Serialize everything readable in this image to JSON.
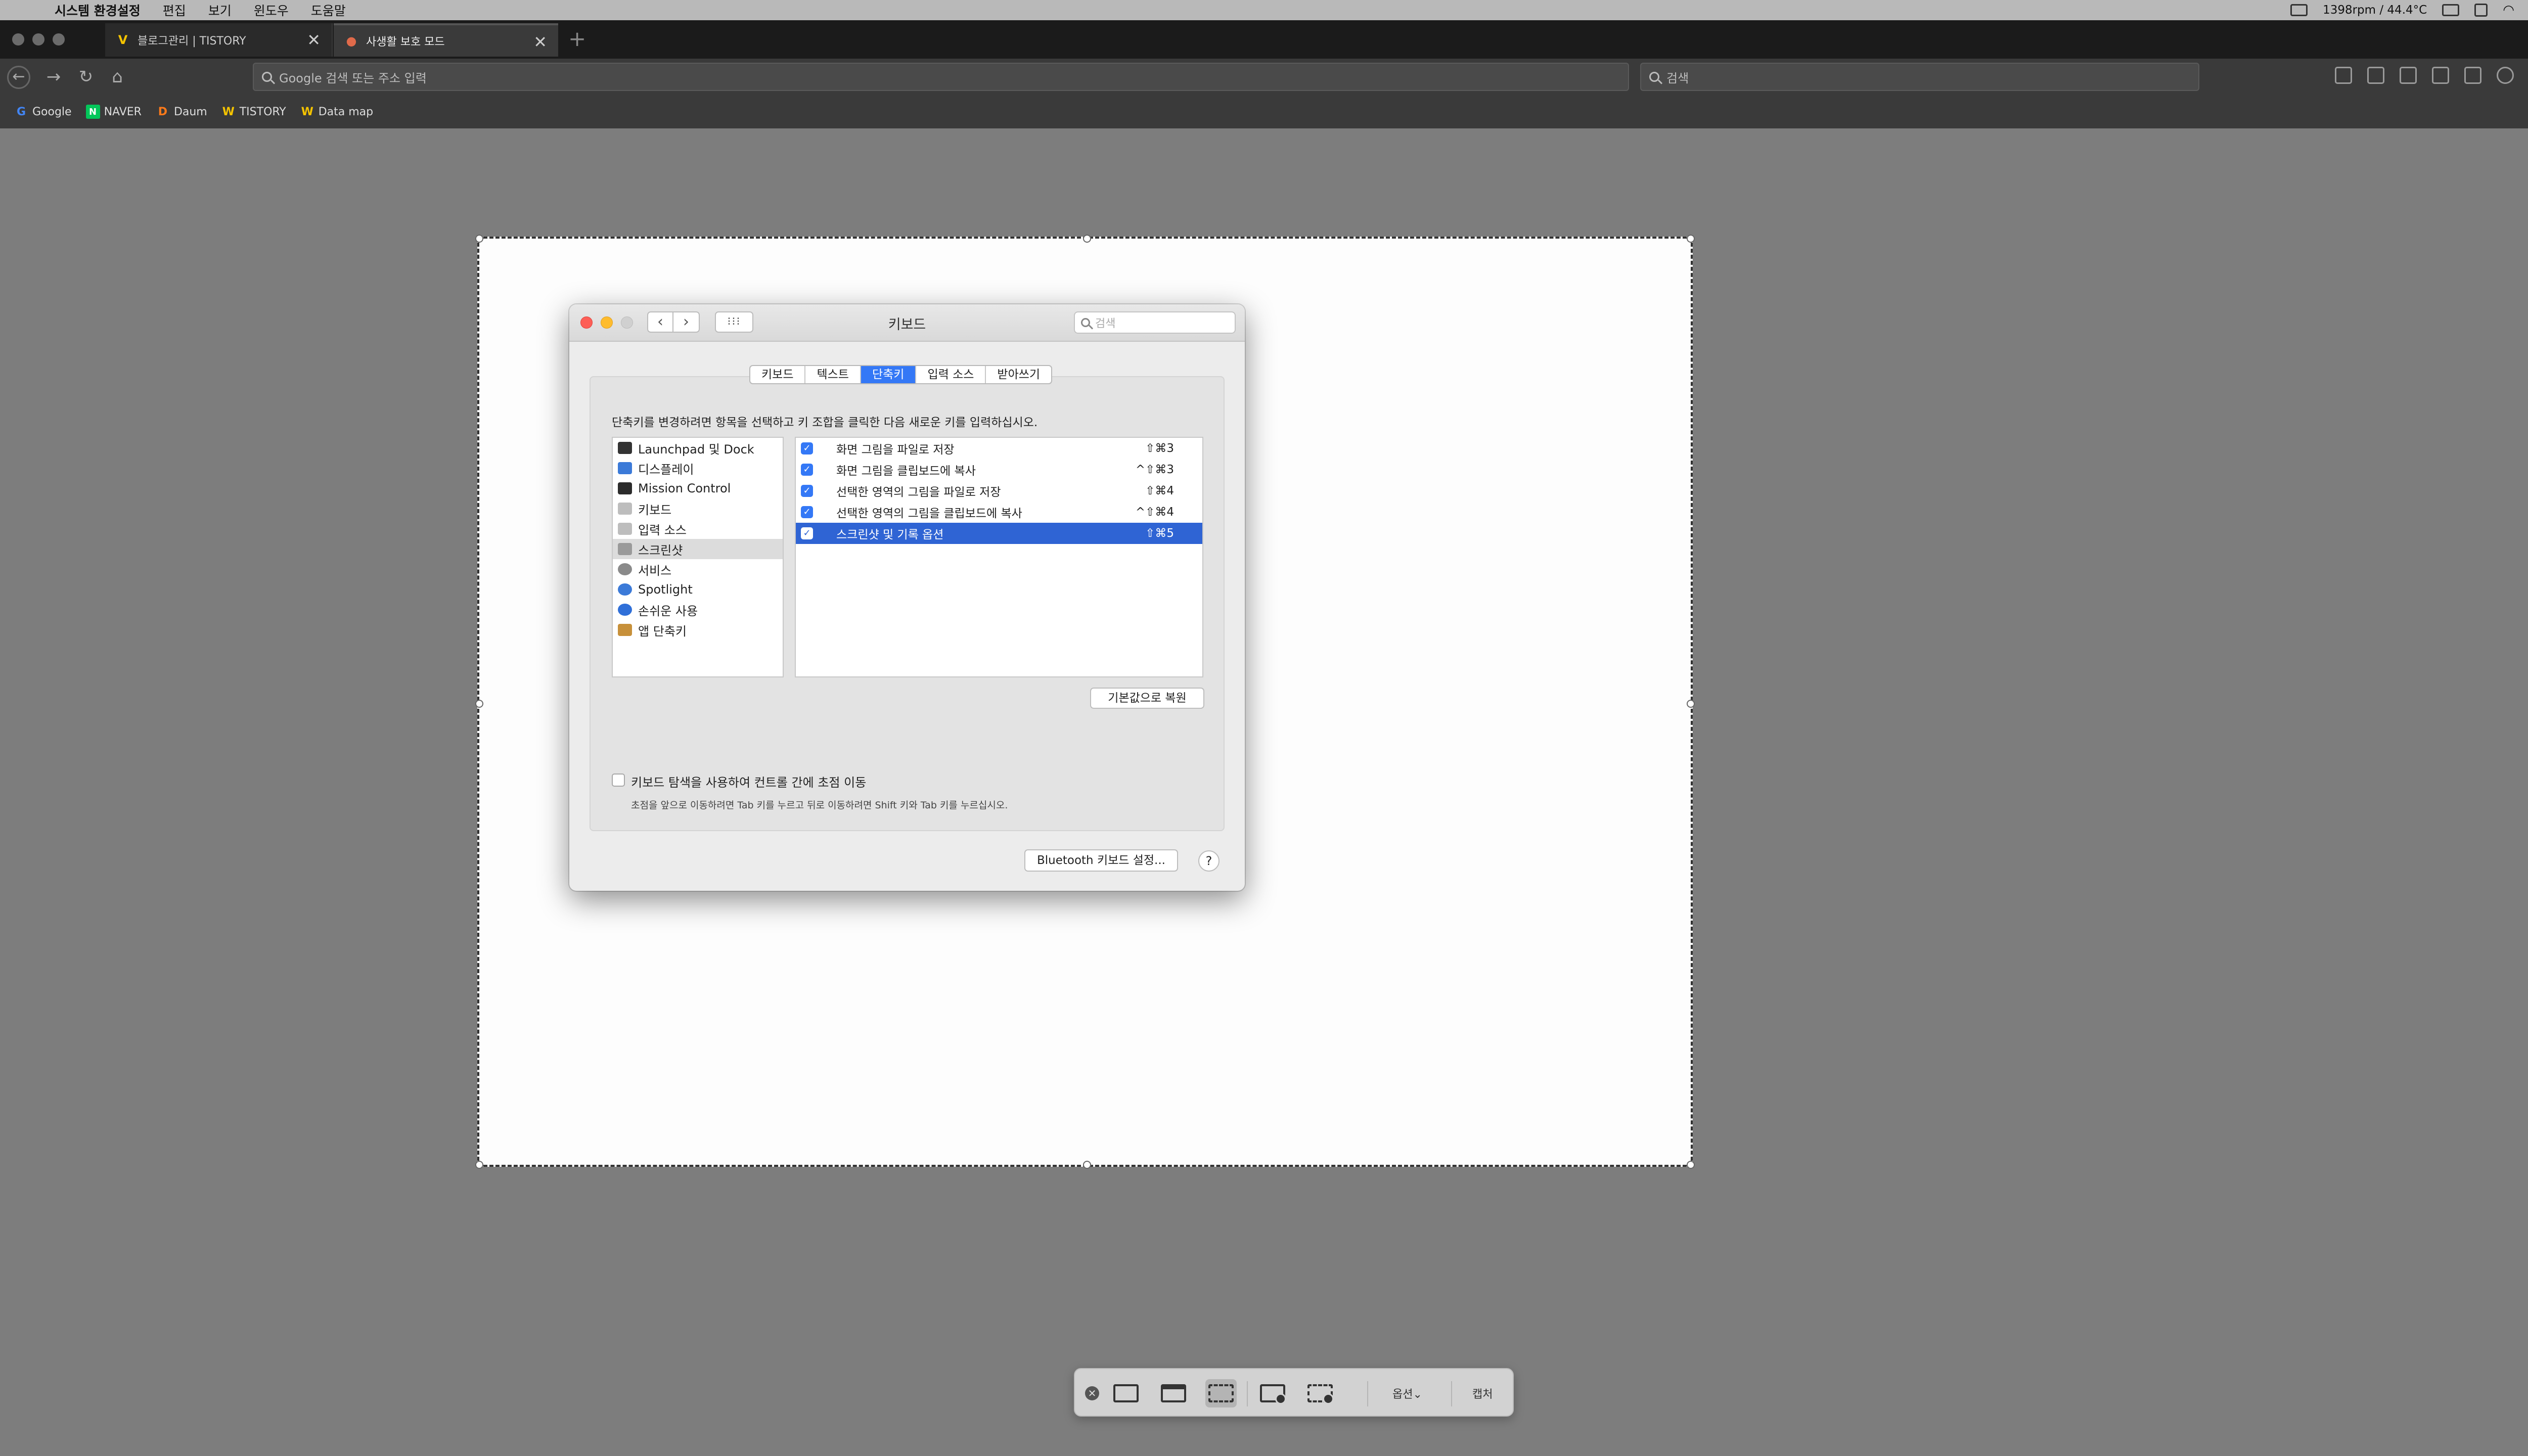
{
  "menubar": {
    "app_name": "시스템 환경설정",
    "items": [
      "편집",
      "보기",
      "윈도우",
      "도움말"
    ],
    "fan_status": "1398rpm / 44.4°C"
  },
  "browser": {
    "tabs": [
      {
        "label": "블로그관리 | TISTORY",
        "favicon": "V"
      },
      {
        "label": "사생활 보호 모드",
        "favicon": "●"
      }
    ],
    "url_placeholder": "Google 검색 또는 주소 입력",
    "search_placeholder": "검색",
    "bookmarks": [
      {
        "label": "Google",
        "favicon": "G",
        "color": "#4285f4"
      },
      {
        "label": "NAVER",
        "favicon": "N",
        "color": "#03c75a"
      },
      {
        "label": "Daum",
        "favicon": "D",
        "color": "#ff5a00"
      },
      {
        "label": "TISTORY",
        "favicon": "W",
        "color": "#f4c300"
      },
      {
        "label": "Data map",
        "favicon": "W",
        "color": "#f4c300"
      }
    ]
  },
  "prefs": {
    "title": "키보드",
    "search_placeholder": "검색",
    "tabs": [
      "키보드",
      "텍스트",
      "단축키",
      "입력 소스",
      "받아쓰기"
    ],
    "selected_tab": "단축키",
    "instruction": "단축키를 변경하려면 항목을 선택하고 키 조합을 클릭한 다음 새로운 키를 입력하십시오.",
    "categories": [
      {
        "label": "Launchpad 및 Dock",
        "icon": "launchpad-icon",
        "color": "#333"
      },
      {
        "label": "디스플레이",
        "icon": "display-icon",
        "color": "#3b7ad8"
      },
      {
        "label": "Mission Control",
        "icon": "mission-control-icon",
        "color": "#2b2b2b"
      },
      {
        "label": "키보드",
        "icon": "keyboard-icon",
        "color": "#bdbdbd"
      },
      {
        "label": "입력 소스",
        "icon": "input-source-icon",
        "color": "#bdbdbd"
      },
      {
        "label": "스크린샷",
        "icon": "screenshot-icon",
        "color": "#9a9a9a",
        "selected": true
      },
      {
        "label": "서비스",
        "icon": "services-gear-icon",
        "color": "#8a8a8a"
      },
      {
        "label": "Spotlight",
        "icon": "spotlight-icon",
        "color": "#3b7ad8"
      },
      {
        "label": "손쉬운 사용",
        "icon": "accessibility-icon",
        "color": "#2f6fd8"
      },
      {
        "label": "앱 단축키",
        "icon": "app-shortcuts-icon",
        "color": "#c7903a"
      }
    ],
    "shortcuts": [
      {
        "label": "화면 그림을 파일로 저장",
        "keys": "⇧⌘3",
        "checked": true
      },
      {
        "label": "화면 그림을 클립보드에 복사",
        "keys": "^⇧⌘3",
        "checked": true
      },
      {
        "label": "선택한 영역의 그림을 파일로 저장",
        "keys": "⇧⌘4",
        "checked": true
      },
      {
        "label": "선택한 영역의 그림을 클립보드에 복사",
        "keys": "^⇧⌘4",
        "checked": true
      },
      {
        "label": "스크린샷 및 기록 옵션",
        "keys": "⇧⌘5",
        "checked": true,
        "selected": true
      }
    ],
    "restore_button": "기본값으로 복원",
    "kb_nav_label": "키보드 탐색을 사용하여 컨트롤 간에 초점 이동",
    "kb_nav_desc": "초점을 앞으로 이동하려면 Tab 키를 누르고 뒤로 이동하려면 Shift 키와 Tab 키를 누르십시오.",
    "bluetooth_button": "Bluetooth 키보드 설정...",
    "help_button": "?"
  },
  "shot_toolbar": {
    "options_label": "옵션⌄",
    "capture_label": "캡처"
  }
}
